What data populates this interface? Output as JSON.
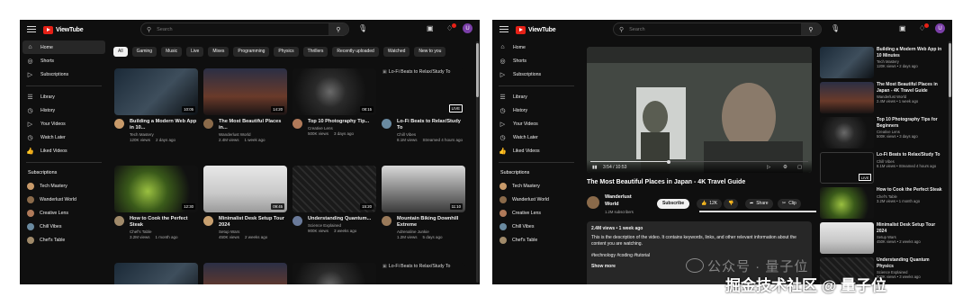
{
  "app": {
    "name": "ViewTube"
  },
  "search": {
    "placeholder": "Search"
  },
  "user": {
    "avatar_letter": "U"
  },
  "sidebar": {
    "main": [
      {
        "label": "Home",
        "icon": "home-icon"
      },
      {
        "label": "Shorts",
        "icon": "shorts-icon"
      },
      {
        "label": "Subscriptions",
        "icon": "subscriptions-icon"
      }
    ],
    "library": [
      {
        "label": "Library",
        "icon": "library-icon"
      },
      {
        "label": "History",
        "icon": "history-icon"
      },
      {
        "label": "Your Videos",
        "icon": "your-videos-icon"
      },
      {
        "label": "Watch Later",
        "icon": "watch-later-icon"
      },
      {
        "label": "Liked Videos",
        "icon": "liked-icon"
      }
    ],
    "subscriptions_heading": "Subscriptions",
    "subscriptions": [
      {
        "label": "Tech Mastery",
        "color": "#c89a6a"
      },
      {
        "label": "Wanderlust World",
        "color": "#8a6a4a"
      },
      {
        "label": "Creative Lens",
        "color": "#b07a5a"
      },
      {
        "label": "Chill Vibes",
        "color": "#6a8aa0"
      },
      {
        "label": "Chef's Table",
        "color": "#a08a6a"
      }
    ]
  },
  "chips": [
    "All",
    "Gaming",
    "Music",
    "Live",
    "Mixes",
    "Programming",
    "Physics",
    "Thrillers",
    "Recently uploaded",
    "Watched",
    "New to you"
  ],
  "videos": [
    {
      "title": "Building a Modern Web App in 10...",
      "channel": "Tech Mastery",
      "views": "120K views",
      "age": "2 days ago",
      "duration": "10:05"
    },
    {
      "title": "The Most Beautiful Places in...",
      "channel": "Wanderlust World",
      "views": "2.4M views",
      "age": "1 week ago",
      "duration": "14:20"
    },
    {
      "title": "Top 10 Photography Tip...",
      "channel": "Creative Lens",
      "views": "500K views",
      "age": "3 days ago",
      "duration": "08:15"
    },
    {
      "title": "Lo-Fi Beats to Relax/Study To",
      "channel": "Chill Vibes",
      "views": "8.1M views",
      "age": "Streamed 4 hours ago",
      "duration": "LIVE",
      "broken_alt": "Lo-Fi Beats to Relax/Study To"
    },
    {
      "title": "How to Cook the Perfect Steak",
      "channel": "Chef's Table",
      "views": "3.2M views",
      "age": "1 month ago",
      "duration": "12:30"
    },
    {
      "title": "Minimalist Desk Setup Tour 2024",
      "channel": "Setup Wars",
      "views": "450K views",
      "age": "2 weeks ago",
      "duration": "09:45"
    },
    {
      "title": "Understanding Quantum...",
      "channel": "Science Explained",
      "views": "900K views",
      "age": "3 weeks ago",
      "duration": "15:20"
    },
    {
      "title": "Mountain Biking Downhill Extreme",
      "channel": "Adrenaline Junkie",
      "views": "1.2M views",
      "age": "5 days ago",
      "duration": "11:10"
    }
  ],
  "row3_broken_alt": "Lo-Fi Beats to Relax/Study To",
  "watch": {
    "title": "The Most Beautiful Places in Japan - 4K Travel Guide",
    "time": "3:54 / 10:53",
    "progress": 0.36,
    "channel": "Wanderlust World",
    "subscribers": "1.2M subscribers",
    "subscribe": "Subscribe",
    "likes": "12K",
    "share": "Share",
    "clip": "Clip",
    "stats": "2.4M views • 1 week ago",
    "description": "This is the description of the video. It contains keywords, links, and other relevant information about the content you are watching.",
    "tags": "#technology #coding #tutorial",
    "more": "Show more"
  },
  "recommended": [
    {
      "title": "Building a Modern Web App in 10 Minutes",
      "channel": "Tech Mastery",
      "stats": "120K views • 2 days ago"
    },
    {
      "title": "The Most Beautiful Places in Japan - 4K Travel Guide",
      "channel": "Wanderlust World",
      "stats": "2.4M views • 1 week ago"
    },
    {
      "title": "Top 10 Photography Tips for Beginners",
      "channel": "Creative Lens",
      "stats": "500K views • 3 days ago"
    },
    {
      "title": "Lo-Fi Beats to Relax/Study To",
      "channel": "Chill Vibes",
      "stats": "8.1M views • Streamed 4 hours ago",
      "duration": "LIVE"
    },
    {
      "title": "How to Cook the Perfect Steak",
      "channel": "Chef's Table",
      "stats": "3.2M views • 1 month ago"
    },
    {
      "title": "Minimalist Desk Setup Tour 2024",
      "channel": "Setup Wars",
      "stats": "450K views • 2 weeks ago"
    },
    {
      "title": "Understanding Quantum Physics",
      "channel": "Science Explained",
      "stats": "900K views • 3 weeks ago"
    }
  ],
  "watermark": {
    "line1": "公众号 · 量子位",
    "line2": "掘金技术社区 @ 量子位"
  }
}
